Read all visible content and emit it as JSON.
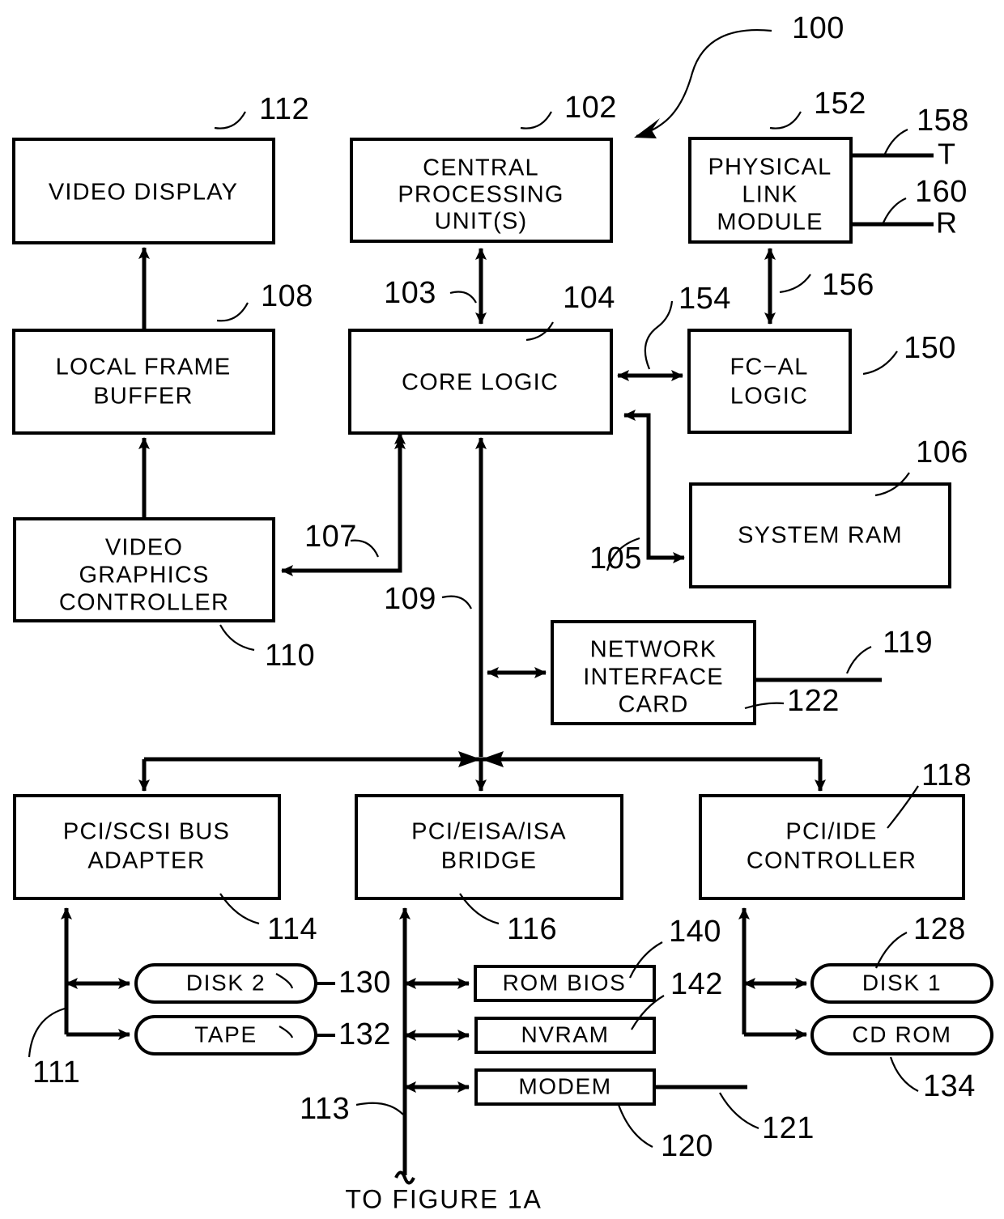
{
  "figure": {
    "reference_numeral": "100",
    "caption": "TO  FIGURE  1A"
  },
  "blocks": {
    "video_display": {
      "label": "VIDEO  DISPLAY",
      "ref": "112"
    },
    "cpu": {
      "line1": "CENTRAL",
      "line2": "PROCESSING",
      "line3": "UNIT(S)",
      "ref": "102"
    },
    "physical_link": {
      "line1": "PHYSICAL",
      "line2": "LINK",
      "line3": "MODULE",
      "ref": "152"
    },
    "local_frame_buffer": {
      "line1": "LOCAL  FRAME",
      "line2": "BUFFER",
      "ref": "108"
    },
    "core_logic": {
      "label": "CORE  LOGIC",
      "ref": "104"
    },
    "fcal_logic": {
      "line1": "FC−AL",
      "line2": "LOGIC",
      "ref": "150"
    },
    "system_ram": {
      "label": "SYSTEM  RAM",
      "ref": "106"
    },
    "video_graphics": {
      "line1": "VIDEO",
      "line2": "GRAPHICS",
      "line3": "CONTROLLER",
      "ref": "110"
    },
    "network_interface": {
      "line1": "NETWORK",
      "line2": "INTERFACE",
      "line3": "CARD",
      "ref": "122",
      "link_ref": "119"
    },
    "pci_scsi": {
      "line1": "PCI/SCSI  BUS",
      "line2": "ADAPTER",
      "ref": "114"
    },
    "pci_eisa": {
      "line1": "PCI/EISA/ISA",
      "line2": "BRIDGE",
      "ref": "116"
    },
    "pci_ide": {
      "line1": "PCI/IDE",
      "line2": "CONTROLLER",
      "ref": "118"
    }
  },
  "peripherals": {
    "disk2": {
      "label": "DISK  2",
      "ref": "130"
    },
    "tape": {
      "label": "TAPE",
      "ref": "132"
    },
    "rom_bios": {
      "label": "ROM  BIOS",
      "ref": "140"
    },
    "nvram": {
      "label": "NVRAM",
      "ref": "142"
    },
    "modem": {
      "label": "MODEM",
      "ref": "120",
      "line_ref": "121"
    },
    "disk1": {
      "label": "DISK  1",
      "ref": "128"
    },
    "cdrom": {
      "label": "CD  ROM",
      "ref": "134"
    }
  },
  "terminals": {
    "transmit": {
      "label": "T",
      "ref": "158"
    },
    "receive": {
      "label": "R",
      "ref": "160"
    }
  },
  "bus_refs": {
    "cpu_bus": "103",
    "ram_bus": "105",
    "video_bus": "107",
    "pci_bus": "109",
    "scsi_bus": "111",
    "isa_bus": "113",
    "fcal_bus": "154",
    "link_bus": "156"
  },
  "colors": {
    "ink": "#000000",
    "paper": "#ffffff"
  }
}
